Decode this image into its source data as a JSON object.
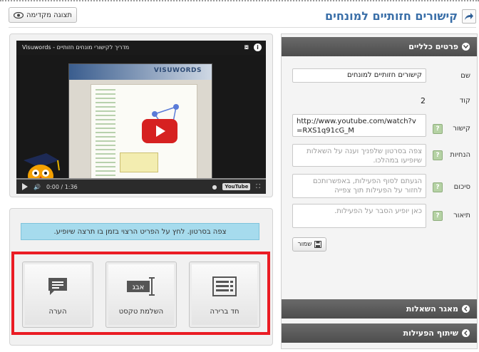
{
  "header": {
    "title": "קישורים חזותיים למונחים",
    "preview_button": "תצוגה מקדימה"
  },
  "video": {
    "title": "Visuwords - מדריך לקישורי מונחים חזותיים",
    "time": "0:00 / 1:36",
    "thumb_logo": "VISUWORDS",
    "youtube_label": "YouTube"
  },
  "hint": "צפה בסרטון. לחץ על הפריט הרצוי בזמן בו תרצה שיופיע.",
  "tools": [
    {
      "label": "חד ברירה",
      "icon": "list-icon"
    },
    {
      "label": "השלמת טקסט",
      "icon": "text-cursor-icon"
    },
    {
      "label": "הערה",
      "icon": "comment-icon"
    }
  ],
  "panel": {
    "general_header": "פרטים כלליים",
    "name_label": "שם",
    "name_value": "קישורים חזותיים למונחים",
    "code_label": "קוד",
    "code_value": "2",
    "link_label": "קישור",
    "link_value": "http://www.youtube.com/watch?v=RXS1q91cG_M",
    "instructions_label": "הנחיות",
    "instructions_placeholder": "צפה בסרטון שלפניך וענה על השאלות שיופיעו במהלכו.",
    "summary_label": "סיכום",
    "summary_placeholder": "הגעתם לסוף הפעילות, באפשרותכם לחזור על הפעילות תוך צפייה",
    "description_label": "תיאור",
    "description_placeholder": "כאן יופיע הסבר על הפעילות.",
    "save_label": "שמור",
    "question_bank": "מאגר השאלות",
    "share_activity": "שיתוף הפעילות",
    "help_glyph": "?"
  },
  "colors": {
    "title": "#3a6fa8",
    "hint_bg": "#a6dbed",
    "highlight": "#ea1c24",
    "header_bg": "#555555",
    "play": "#d62121"
  }
}
